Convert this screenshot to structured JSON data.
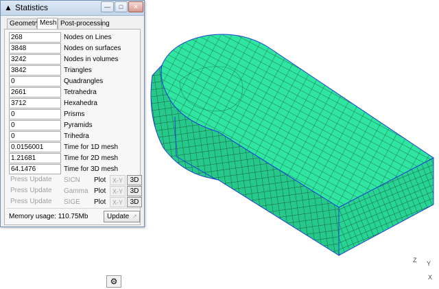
{
  "window": {
    "title": "Statistics",
    "minimize_icon": "minimize-icon",
    "maximize_icon": "maximize-icon",
    "close_icon": "close-icon"
  },
  "tabs": [
    {
      "label": "Geometry"
    },
    {
      "label": "Mesh",
      "active": true
    },
    {
      "label": "Post-processing"
    }
  ],
  "mesh_stats": [
    {
      "value": "268",
      "label": "Nodes on Lines"
    },
    {
      "value": "3848",
      "label": "Nodes on surfaces"
    },
    {
      "value": "3242",
      "label": "Nodes in volumes"
    },
    {
      "value": "3842",
      "label": "Triangles"
    },
    {
      "value": "0",
      "label": "Quadrangles"
    },
    {
      "value": "2661",
      "label": "Tetrahedra"
    },
    {
      "value": "3712",
      "label": "Hexahedra"
    },
    {
      "value": "0",
      "label": "Prisms"
    },
    {
      "value": "0",
      "label": "Pyramids"
    },
    {
      "value": "0",
      "label": "Trihedra"
    },
    {
      "value": "0.0156001",
      "label": "Time for 1D mesh"
    },
    {
      "value": "1.21681",
      "label": "Time for 2D mesh"
    },
    {
      "value": "64.1476",
      "label": "Time for 3D mesh"
    }
  ],
  "quality": [
    {
      "field": "Press Update",
      "name": "SICN",
      "plot": "Plot",
      "xy": "X-Y",
      "three_d": "3D"
    },
    {
      "field": "Press Update",
      "name": "Gamma",
      "plot": "Plot",
      "xy": "X-Y",
      "three_d": "3D"
    },
    {
      "field": "Press Update",
      "name": "SIGE",
      "plot": "Plot",
      "xy": "X-Y",
      "three_d": "3D"
    }
  ],
  "footer": {
    "memory": "Memory usage: 110.75Mb",
    "update_label": "Update"
  },
  "viewport": {
    "mesh_color": "#2ee6a0",
    "mesh_line_color": "#1a1a1a",
    "edge_color": "#1f3fd8",
    "axis_labels": {
      "z": "Z",
      "y": "Y",
      "x": "X"
    }
  }
}
